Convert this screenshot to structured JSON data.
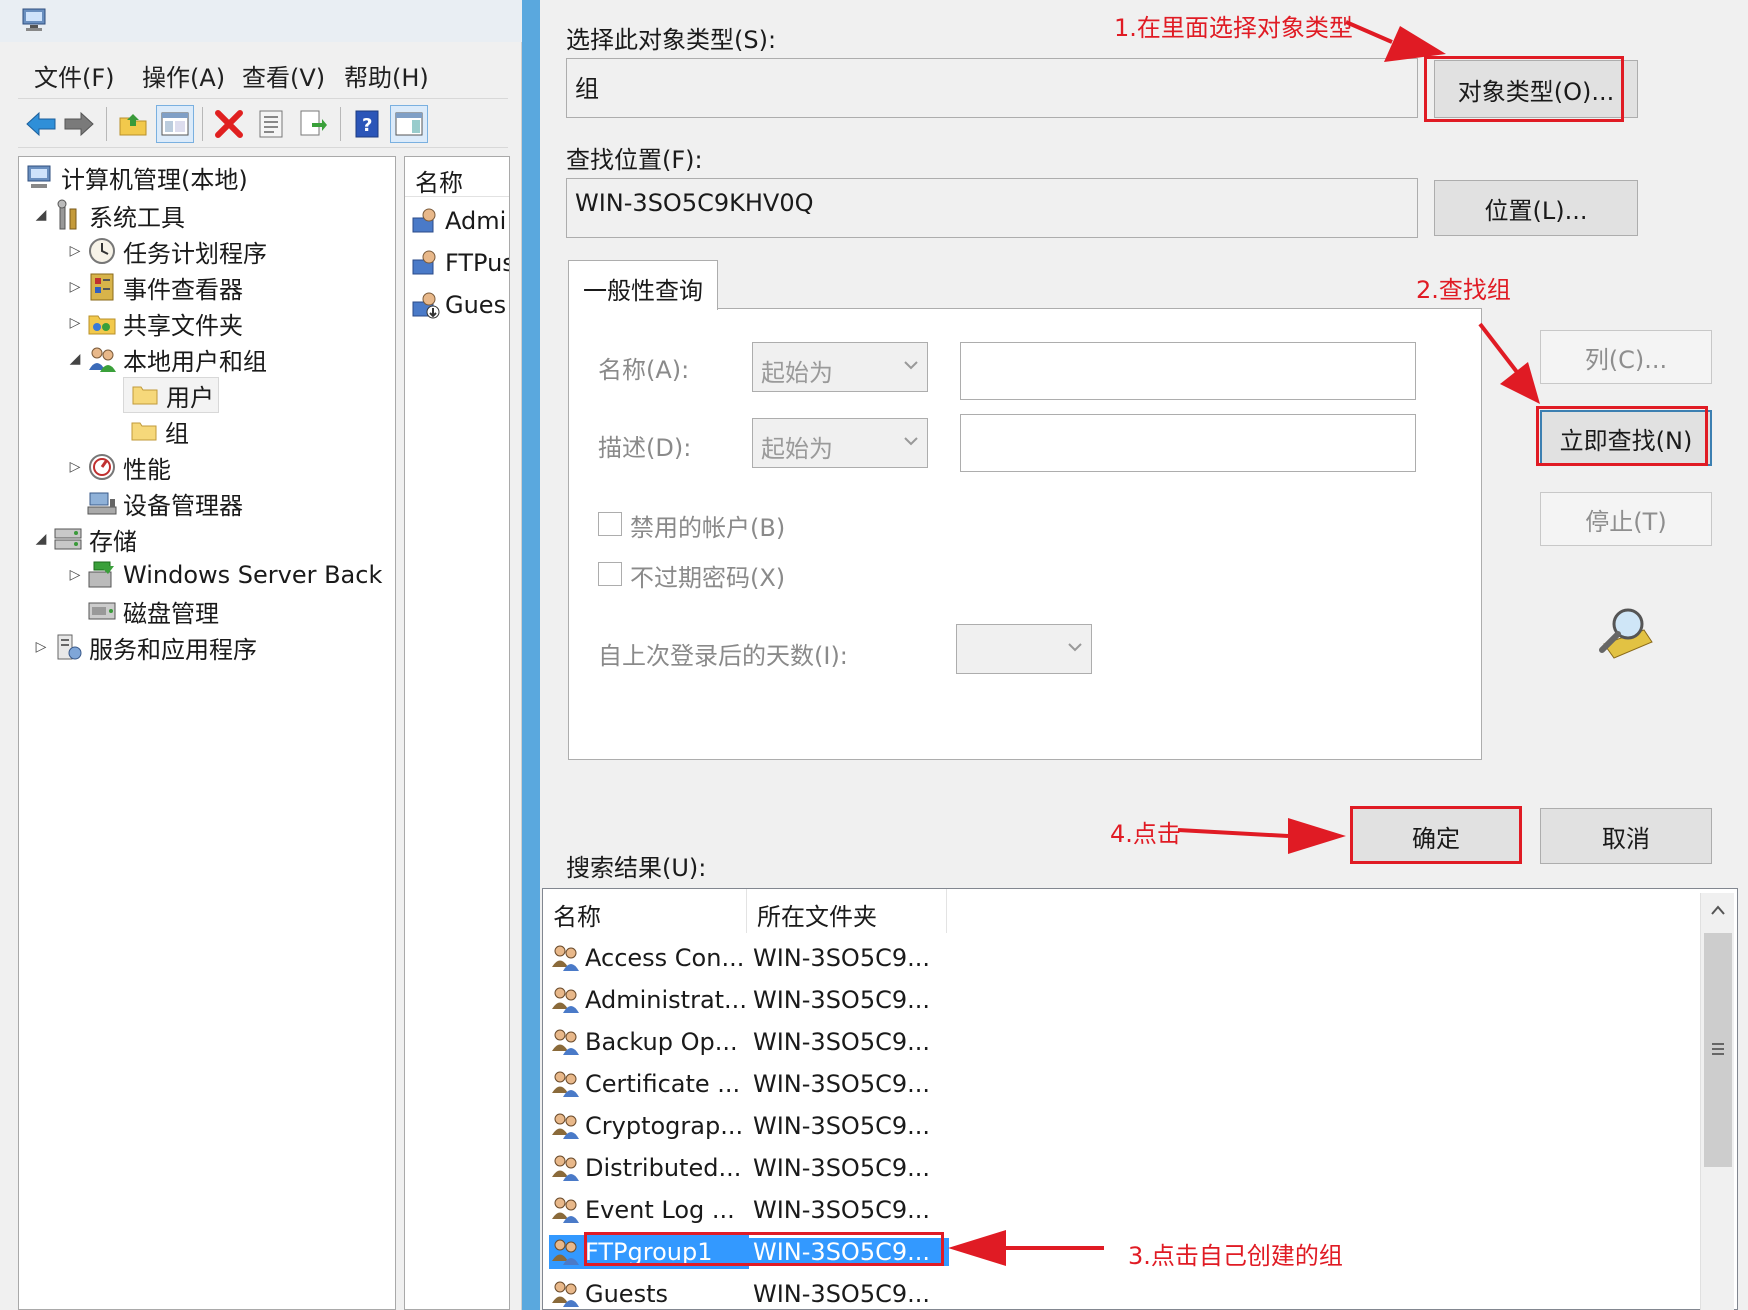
{
  "menu": [
    "文件(F)",
    "操作(A)",
    "查看(V)",
    "帮助(H)"
  ],
  "toolbar_icons": [
    "back-arrow-icon",
    "forward-arrow-icon",
    "up-folder-icon",
    "show-hide-tree-icon",
    "delete-icon",
    "properties-icon",
    "export-icon",
    "help-icon",
    "action-pane-icon"
  ],
  "tree": {
    "root": "计算机管理(本地)",
    "system_tools": "系统工具",
    "task_scheduler": "任务计划程序",
    "event_viewer": "事件查看器",
    "shared_folders": "共享文件夹",
    "local_users_groups": "本地用户和组",
    "users": "用户",
    "groups": "组",
    "performance": "性能",
    "device_manager": "设备管理器",
    "storage": "存储",
    "windows_backup": "Windows Server Back",
    "disk_management": "磁盘管理",
    "services_apps": "服务和应用程序"
  },
  "list_pane": {
    "header": "名称",
    "rows": [
      "Admi",
      "FTPus",
      "Gues"
    ]
  },
  "dialog": {
    "object_type_label": "选择此对象类型(S):",
    "object_type_value": "组",
    "object_types_button": "对象类型(O)...",
    "location_label": "查找位置(F):",
    "location_value": "WIN-3SO5C9KHV0Q",
    "locations_button": "位置(L)...",
    "tab_label": "一般性查询",
    "name_label": "名称(A):",
    "name_combo": "起始为",
    "desc_label": "描述(D):",
    "desc_combo": "起始为",
    "disabled_accounts": "禁用的帐户(B)",
    "non_expiring_pw": "不过期密码(X)",
    "days_since_logon": "自上次登录后的天数(I):",
    "columns_button": "列(C)...",
    "find_now_button": "立即查找(N)",
    "stop_button": "停止(T)",
    "ok_button": "确定",
    "cancel_button": "取消",
    "results_label": "搜索结果(U):"
  },
  "results": {
    "columns": [
      "名称",
      "所在文件夹"
    ],
    "rows": [
      {
        "name": "Access Con...",
        "folder": "WIN-3SO5C9..."
      },
      {
        "name": "Administrat...",
        "folder": "WIN-3SO5C9..."
      },
      {
        "name": "Backup Op...",
        "folder": "WIN-3SO5C9..."
      },
      {
        "name": "Certificate ...",
        "folder": "WIN-3SO5C9..."
      },
      {
        "name": "Cryptograp...",
        "folder": "WIN-3SO5C9..."
      },
      {
        "name": "Distributed...",
        "folder": "WIN-3SO5C9..."
      },
      {
        "name": "Event Log ...",
        "folder": "WIN-3SO5C9..."
      },
      {
        "name": "FTPgroup1",
        "folder": "WIN-3SO5C9...",
        "selected": true
      },
      {
        "name": "Guests",
        "folder": "WIN-3SO5C9..."
      }
    ]
  },
  "annotations": {
    "step1": "1.在里面选择对象类型",
    "step2": "2.查找组",
    "step3": "3.点击自己创建的组",
    "step4": "4.点击"
  },
  "colors": {
    "annotation_red": "#e01b24",
    "selection_blue": "#3399ff",
    "frame_blue": "#5aa8de"
  }
}
